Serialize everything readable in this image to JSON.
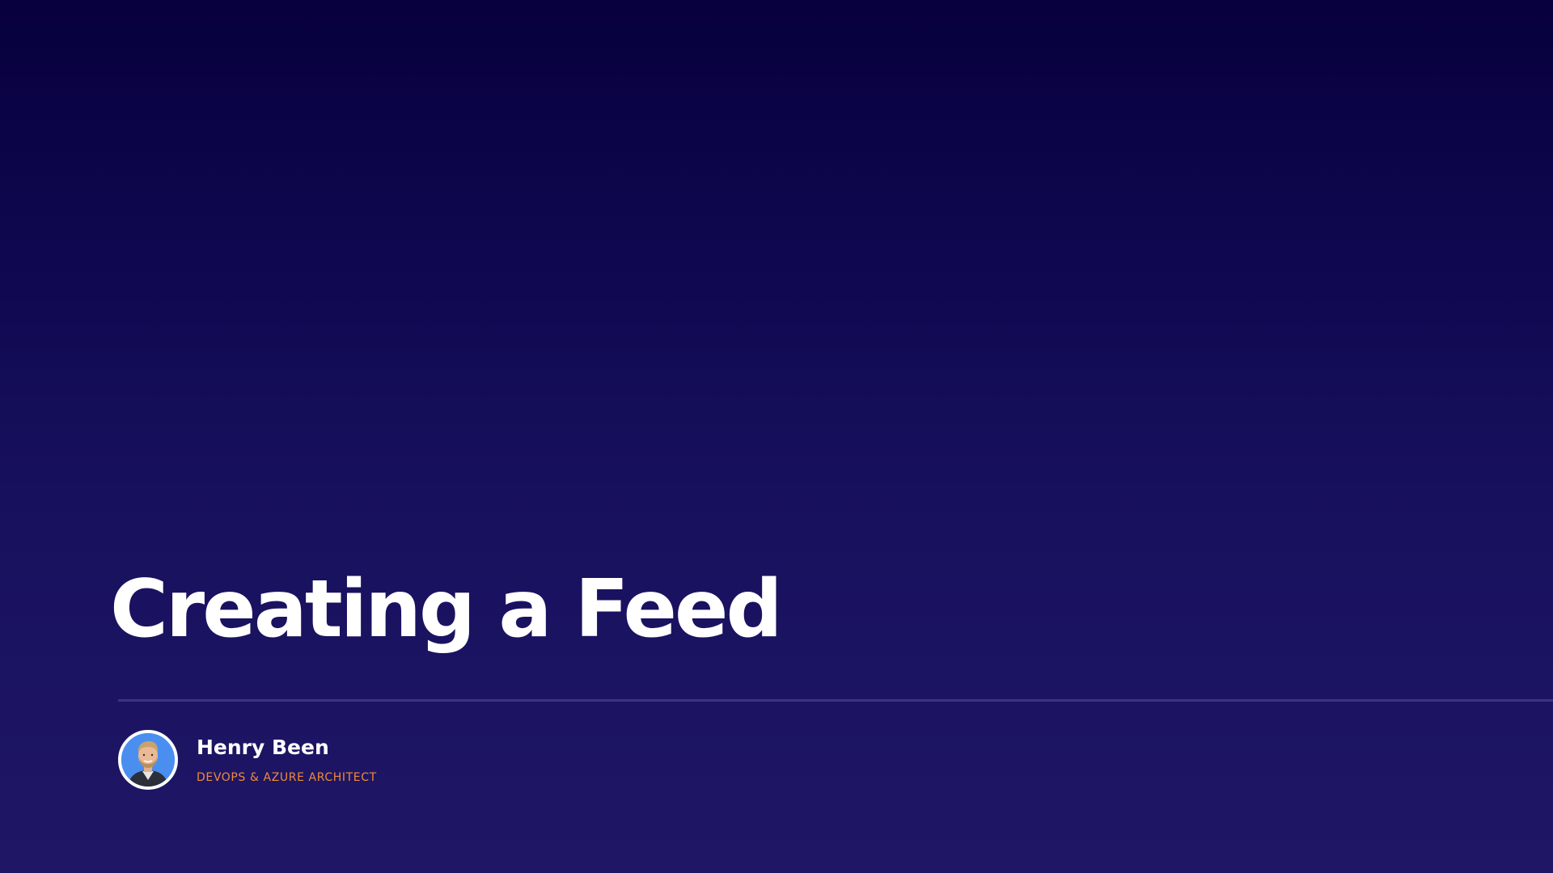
{
  "slide": {
    "title": "Creating a Feed",
    "speaker": {
      "name": "Henry Been",
      "role": "DEVOPS & AZURE ARCHITECT",
      "avatar_icon": "speaker-portrait"
    }
  },
  "colors": {
    "background_top": "#07003d",
    "background_bottom": "#1f1766",
    "title": "#ffffff",
    "divider": "#3b3483",
    "speaker_name": "#ffffff",
    "speaker_role": "#f08a3c",
    "avatar_background": "#4a8ff0"
  }
}
